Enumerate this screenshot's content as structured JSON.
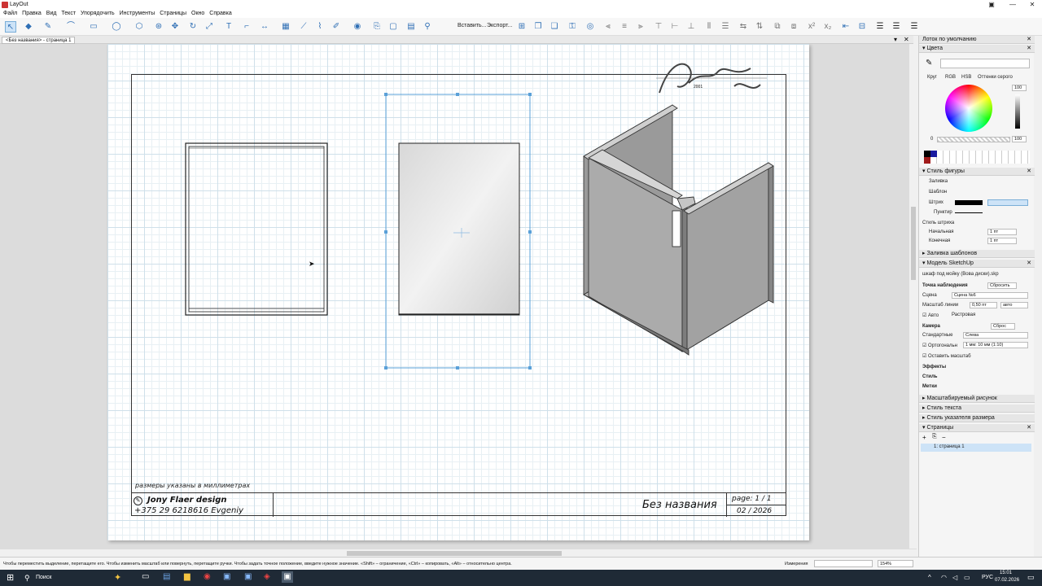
{
  "window": {
    "title": "LayOut"
  },
  "menu": [
    "Файл",
    "Правка",
    "Вид",
    "Текст",
    "Упорядочить",
    "Инструменты",
    "Страницы",
    "Окно",
    "Справка"
  ],
  "toolbar": {
    "insert_label": "Вставить...",
    "export_label": "Экспорт..."
  },
  "document_tab": {
    "label": "<Без названия> - страница 1"
  },
  "page": {
    "logo_text": "Jony Flaer design",
    "logo_year": "2001",
    "note": "размеры указаны в миллиметрах",
    "company": "Jony Flaer design",
    "phone": "+375 29 6218616 Evgeniy",
    "doc_title": "Без названия",
    "page_label": "page: 1 / 1",
    "date": "02 / 2026"
  },
  "panel": {
    "title": "Лоток по умолчанию",
    "colors": {
      "header": "Цвета",
      "tabs": [
        "Круг",
        "RGB",
        "HSB",
        "Оттенки серого"
      ],
      "value_top": "100",
      "value_left": "0",
      "value_right": "100"
    },
    "shape_style": {
      "header": "Стиль фигуры",
      "fill": "Заливка",
      "pattern": "Шаблон",
      "stroke": "Штрих",
      "dash": "Пунктир",
      "stroke_style": "Стиль штриха",
      "start": "Начальная",
      "end": "Конечная",
      "width_start": "1 пт",
      "width_end": "1 пт"
    },
    "pattern_fill": "Заливка шаблонов",
    "sketchup": {
      "header": "Модель SketchUp",
      "file": "шкаф под мойку (Вова диски).skp",
      "viewpoint": "Точка наблюдения",
      "reset": "Сбросить",
      "scene_label": "Сцена",
      "scene_value": "Сцена №6",
      "line_scale_label": "Масштаб линии",
      "line_scale_value": "0,50 пт",
      "line_scale_mode": "авто",
      "auto": "Авто",
      "raster": "Растровая",
      "camera": "Камера",
      "camera_reset": "Сброс",
      "standard_label": "Стандартные",
      "standard_value": "Слева",
      "ortho_label": "Ортогональн",
      "ortho_value": "1 мм: 10 мм (1:10)",
      "keep_scale": "Оставить масштаб",
      "effects": "Эффекты",
      "style": "Стиль",
      "tags": "Метки"
    },
    "scaled_drawing": "Масштабируемый рисунок",
    "text_style": "Стиль текста",
    "dimension_style": "Стиль указателя размера",
    "pages": {
      "header": "Страницы",
      "item": "1: страница 1"
    }
  },
  "status": {
    "hint": "Чтобы переместить выделение, перетащите его. Чтобы изменить масштаб или повернуть, перетащите ручки. Чтобы задать точное положение, введите нужное значение. «Shift» – ограничение, «Ctrl» – копировать, «Alt» – относительно центра.",
    "measure_label": "Измерения",
    "zoom": "154%"
  },
  "taskbar": {
    "search": "Поиск",
    "lang": "РУС",
    "time": "15:01",
    "date": "07.02.2026"
  }
}
